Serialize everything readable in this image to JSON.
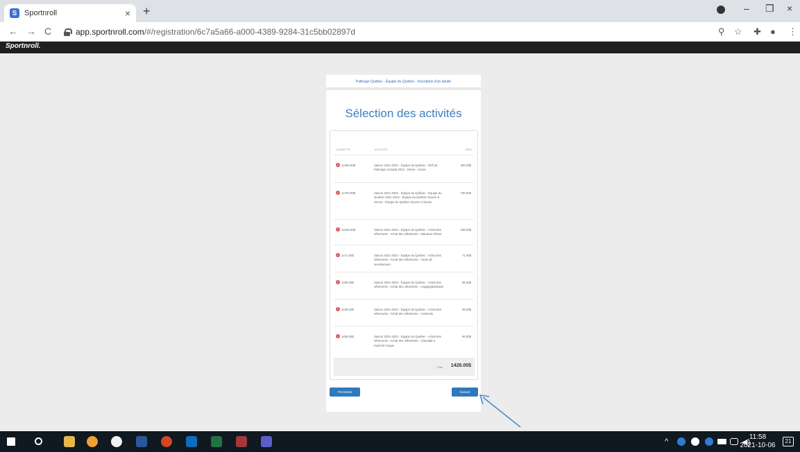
{
  "browser": {
    "tab_title": "Sportnroll",
    "tab_favicon": "S",
    "tab_close": "×",
    "new_tab": "+",
    "minimize": "–",
    "maximize": "❐",
    "close": "×",
    "url_host": "app.sportnroll.com",
    "url_path": "/#/registration/6c7a5a66-a000-4389-9284-31c5bb02897d",
    "back": "←",
    "forward": "→",
    "reload": "C",
    "zoom_icon": "⚲",
    "star_icon": "☆",
    "extensions_icon": "✚",
    "profile_icon": "●",
    "menu_icon": "⋮"
  },
  "app": {
    "logo": "Sportnroll."
  },
  "registration": {
    "breadcrumb": "Patinage Québec - Équipe du Québec - Inscription d'un adulte",
    "heading": "Sélection des activités",
    "columns": {
      "quantity": "QUANTITÉ",
      "activity": "ACTIVITÉ",
      "price": "PRIX"
    },
    "remove_symbol": "×",
    "items": [
      {
        "qty": "1x300.00$",
        "activity": "Saison 2021-2022 - Équipe du Québec - Défi de Patinage Canada 2022 - Dame - Junior",
        "price": "300.00$"
      },
      {
        "qty": "1x700.00$",
        "activity": "Saison 2021-2022 - Équipe du Québec - Équipe du Québec 2021-2022 - Équipe du Québec Novice à Senior - Équipe du Québec Novice à Senior",
        "price": "700.00$"
      },
      {
        "qty": "1x196.00$",
        "activity": "Saison 2021-2022 - Équipe du Québec - Achat des vêtements - Achat des vêtements - Manteau d'hiver",
        "price": "196.00$"
      },
      {
        "qty": "1x71.00$",
        "activity": "Saison 2021-2022 - Équipe du Québec - Achat des vêtements - Achat des vêtements - Veste de survêtement",
        "price": "71.00$"
      },
      {
        "qty": "1x55.00$",
        "activity": "Saison 2021-2022 - Équipe du Québec - Achat des vêtements - Achat des vêtements - Legging/pantalon",
        "price": "55.00$"
      },
      {
        "qty": "1x39.00$",
        "activity": "Saison 2021-2022 - Équipe du Québec - Achat des vêtements - Achat des vêtements - Camisole",
        "price": "39.00$"
      },
      {
        "qty": "1x65.00$",
        "activity": "Saison 2021-2022 - Équipe du Québec - Achat des vêtements - Achat des vêtements - Chandail à manche longue",
        "price": "65.00$"
      }
    ],
    "total_label": "Total",
    "total_value": "1426.00$",
    "prev_button": "Précédent",
    "next_button": "Suivant"
  },
  "taskbar": {
    "time": "11:58",
    "date": "2021-10-06",
    "notifications": "21",
    "tray_chevron": "^"
  }
}
